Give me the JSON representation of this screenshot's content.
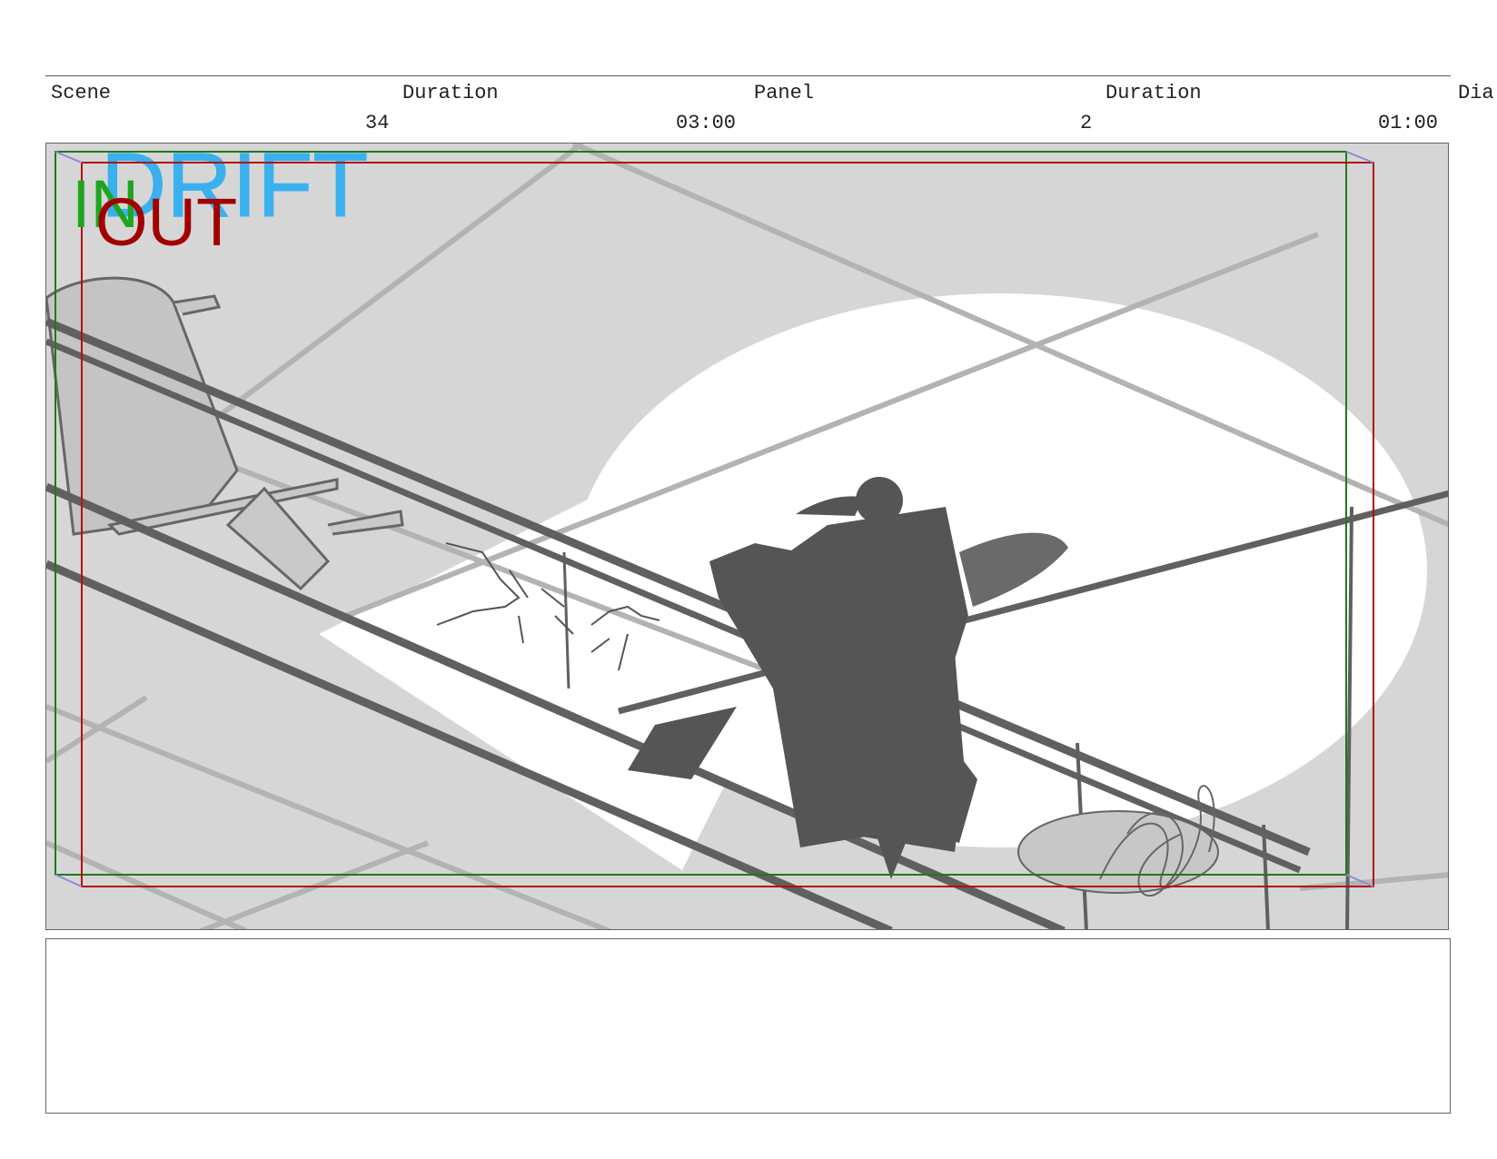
{
  "header": {
    "scene_label": "Scene",
    "scene_duration_label": "Duration",
    "panel_label": "Panel",
    "panel_duration_label": "Duration",
    "dialogue_label": "Dia",
    "scene_number": "34",
    "scene_duration": "03:00",
    "panel_number": "2",
    "panel_duration": "01:00"
  },
  "panel": {
    "in_marker": "IN",
    "out_marker": "OUT",
    "sketch_text": "DRIFT",
    "colors": {
      "in_safe": "#1fa51f",
      "out_safe": "#a10000",
      "sketch_note": "#3ab0ee",
      "silhouette": "#555555"
    }
  },
  "notes": {
    "text": ""
  }
}
